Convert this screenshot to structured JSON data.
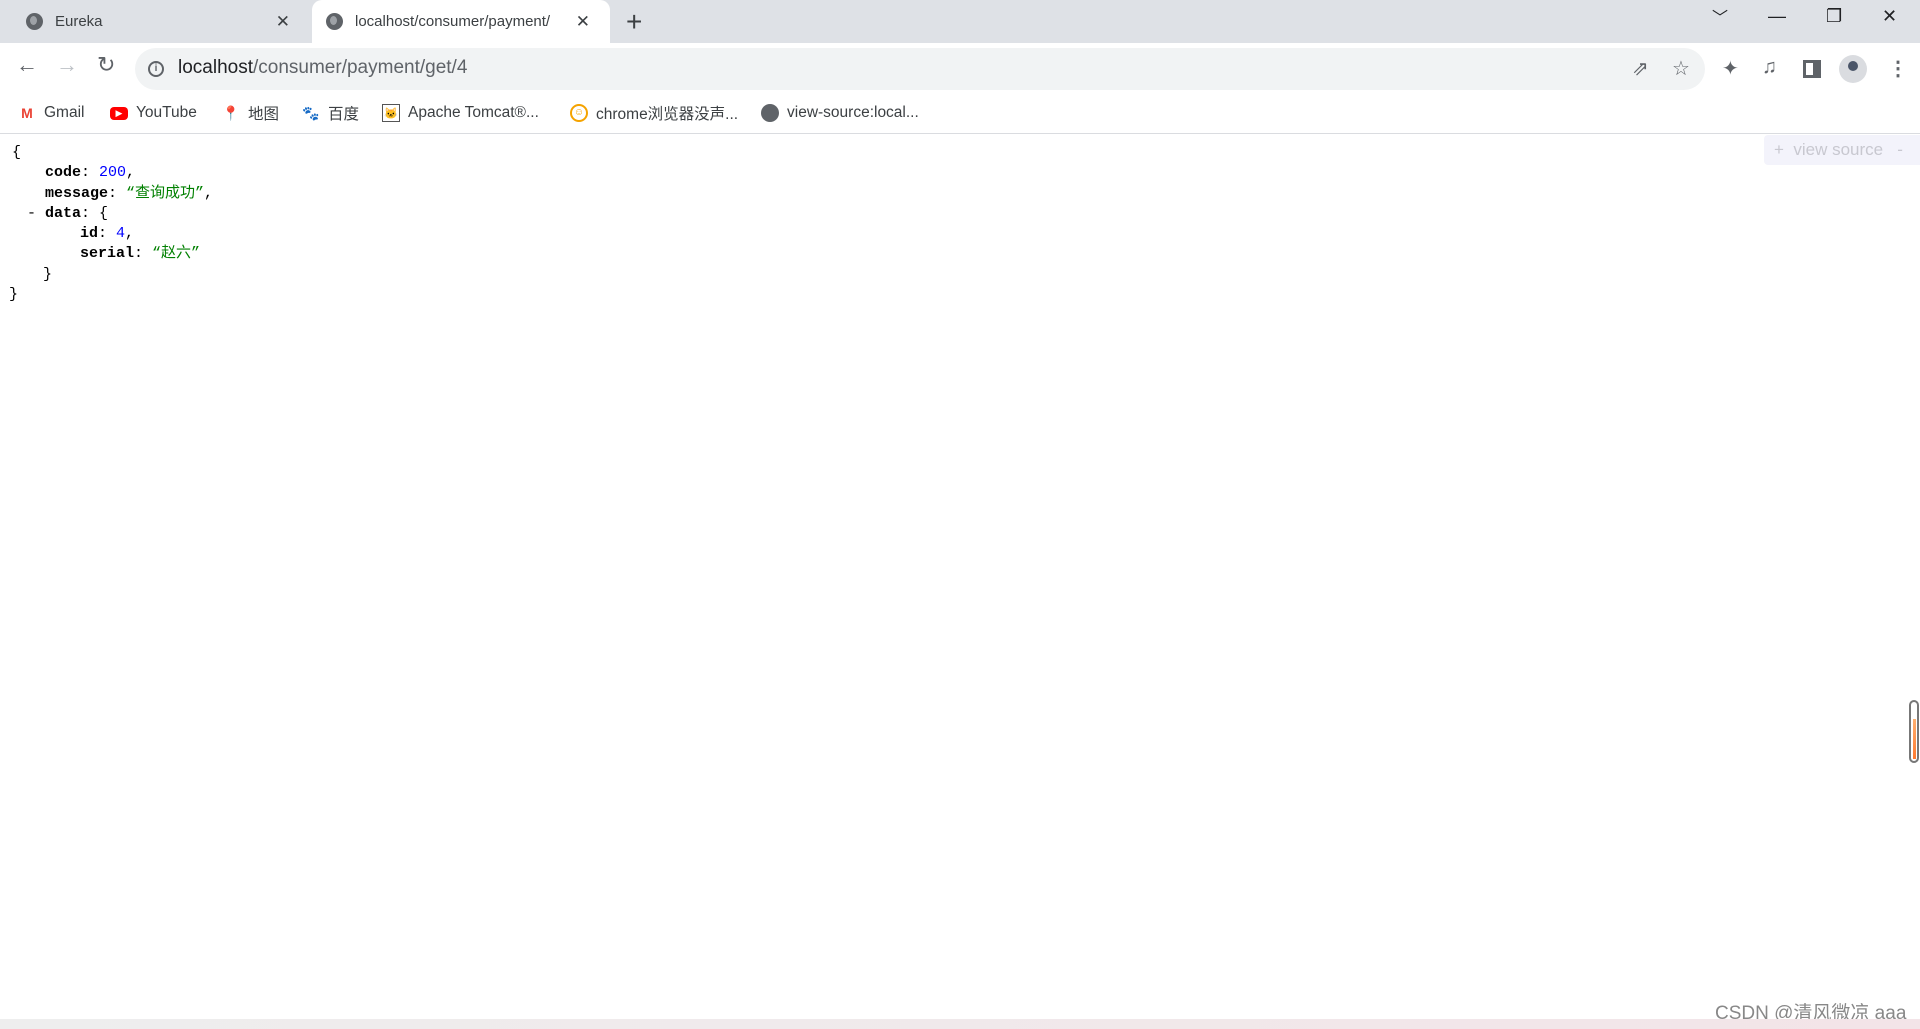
{
  "tabs": [
    {
      "title": "Eureka",
      "icon": "globe-icon"
    },
    {
      "title": "localhost/consumer/payment/",
      "icon": "globe-icon",
      "active": true
    }
  ],
  "address": {
    "host": "localhost",
    "path": "/consumer/payment/get/4"
  },
  "bookmarks": [
    {
      "label": "Gmail",
      "icon": "gmail-icon"
    },
    {
      "label": "YouTube",
      "icon": "youtube-icon"
    },
    {
      "label": "地图",
      "icon": "maps-icon"
    },
    {
      "label": "百度",
      "icon": "baidu-icon"
    },
    {
      "label": "Apache Tomcat®...",
      "icon": "tomcat-icon"
    },
    {
      "label": "chrome浏览器没声...",
      "icon": "smiley-icon"
    },
    {
      "label": "view-source:local...",
      "icon": "globe-icon"
    }
  ],
  "json_view": {
    "open_brace": "{",
    "close_brace": "}",
    "code_key": "code",
    "code_value": "200",
    "message_key": "message",
    "message_value": "“查询成功”",
    "collapse_toggle": "-",
    "data_key": "data",
    "id_key": "id",
    "id_value": "4",
    "serial_key": "serial",
    "serial_value": "“赵六”"
  },
  "view_source": {
    "label": "+  view source   -"
  },
  "watermark": "CSDN @清风微凉 aaa",
  "colors": {
    "number": "#0000ff",
    "string": "#008000",
    "tabbar": "#dee1e6"
  }
}
